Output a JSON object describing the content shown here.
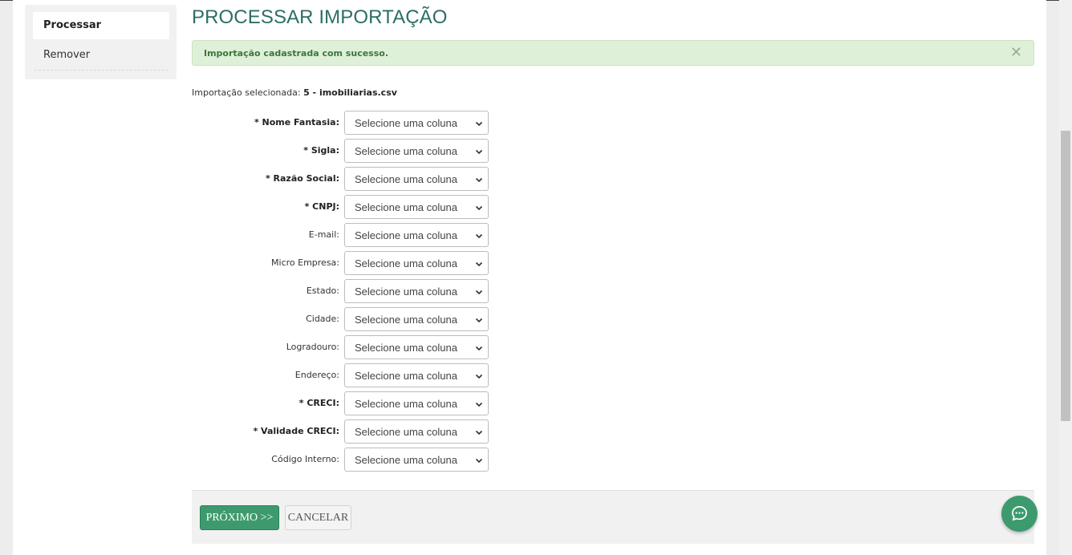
{
  "sidebar": {
    "items": [
      {
        "label": "Processar"
      },
      {
        "label": "Remover"
      }
    ]
  },
  "page_title": "PROCESSAR IMPORTAÇÃO",
  "alert": {
    "message": "Importação cadastrada com sucesso.",
    "close": "✕"
  },
  "selected": {
    "label": "Importação selecionada:",
    "value": "5 - imobiliarias.csv"
  },
  "fields": [
    {
      "label": "* Nome Fantasia:",
      "value": "Selecione uma coluna",
      "required": true
    },
    {
      "label": "* Sigla:",
      "value": "Selecione uma coluna",
      "required": true
    },
    {
      "label": "* Razão Social:",
      "value": "Selecione uma coluna",
      "required": true
    },
    {
      "label": "* CNPJ:",
      "value": "Selecione uma coluna",
      "required": true
    },
    {
      "label": "E-mail:",
      "value": "Selecione uma coluna",
      "required": false
    },
    {
      "label": "Micro Empresa:",
      "value": "Selecione uma coluna",
      "required": false
    },
    {
      "label": "Estado:",
      "value": "Selecione uma coluna",
      "required": false
    },
    {
      "label": "Cidade:",
      "value": "Selecione uma coluna",
      "required": false
    },
    {
      "label": "Logradouro:",
      "value": "Selecione uma coluna",
      "required": false
    },
    {
      "label": "Endereço:",
      "value": "Selecione uma coluna",
      "required": false
    },
    {
      "label": "* CRECI:",
      "value": "Selecione uma coluna",
      "required": true
    },
    {
      "label": "* Validade CRECI:",
      "value": "Selecione uma coluna",
      "required": true
    },
    {
      "label": "Código Interno:",
      "value": "Selecione uma coluna",
      "required": false
    }
  ],
  "footer": {
    "next_label": "PRÓXIMO >>",
    "cancel_label": "CANCELAR"
  },
  "icons": {
    "chat": "chat-bubble-icon",
    "chevron": "chevron-down-icon",
    "close": "close-icon"
  },
  "colors": {
    "title": "#2c6e63",
    "primary_button": "#3d9a6f",
    "alert_bg": "#dff0d8",
    "alert_text": "#3c763d"
  }
}
